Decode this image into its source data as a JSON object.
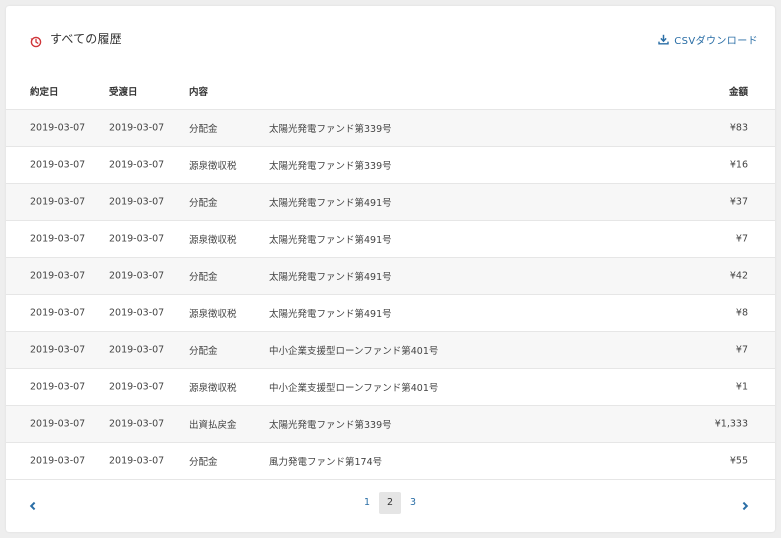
{
  "header": {
    "title": "すべての履歴",
    "csv_label": "CSVダウンロード",
    "accent_color": "#d0363a",
    "link_color": "#2a6ea6"
  },
  "table": {
    "columns": {
      "contract_date": "約定日",
      "delivery_date": "受渡日",
      "type": "内容",
      "fund": "",
      "amount": "金額"
    },
    "rows": [
      {
        "contract_date": "2019-03-07",
        "delivery_date": "2019-03-07",
        "type": "分配金",
        "fund": "太陽光発電ファンド第339号",
        "amount": "¥83"
      },
      {
        "contract_date": "2019-03-07",
        "delivery_date": "2019-03-07",
        "type": "源泉徴収税",
        "fund": "太陽光発電ファンド第339号",
        "amount": "¥16"
      },
      {
        "contract_date": "2019-03-07",
        "delivery_date": "2019-03-07",
        "type": "分配金",
        "fund": "太陽光発電ファンド第491号",
        "amount": "¥37"
      },
      {
        "contract_date": "2019-03-07",
        "delivery_date": "2019-03-07",
        "type": "源泉徴収税",
        "fund": "太陽光発電ファンド第491号",
        "amount": "¥7"
      },
      {
        "contract_date": "2019-03-07",
        "delivery_date": "2019-03-07",
        "type": "分配金",
        "fund": "太陽光発電ファンド第491号",
        "amount": "¥42"
      },
      {
        "contract_date": "2019-03-07",
        "delivery_date": "2019-03-07",
        "type": "源泉徴収税",
        "fund": "太陽光発電ファンド第491号",
        "amount": "¥8"
      },
      {
        "contract_date": "2019-03-07",
        "delivery_date": "2019-03-07",
        "type": "分配金",
        "fund": "中小企業支援型ローンファンド第401号",
        "amount": "¥7"
      },
      {
        "contract_date": "2019-03-07",
        "delivery_date": "2019-03-07",
        "type": "源泉徴収税",
        "fund": "中小企業支援型ローンファンド第401号",
        "amount": "¥1"
      },
      {
        "contract_date": "2019-03-07",
        "delivery_date": "2019-03-07",
        "type": "出資払戻金",
        "fund": "太陽光発電ファンド第339号",
        "amount": "¥1,333"
      },
      {
        "contract_date": "2019-03-07",
        "delivery_date": "2019-03-07",
        "type": "分配金",
        "fund": "風力発電ファンド第174号",
        "amount": "¥55"
      }
    ]
  },
  "pagination": {
    "pages": [
      "1",
      "2",
      "3"
    ],
    "current": "2",
    "prev_icon": "chevron-left-icon",
    "next_icon": "chevron-right-icon"
  }
}
